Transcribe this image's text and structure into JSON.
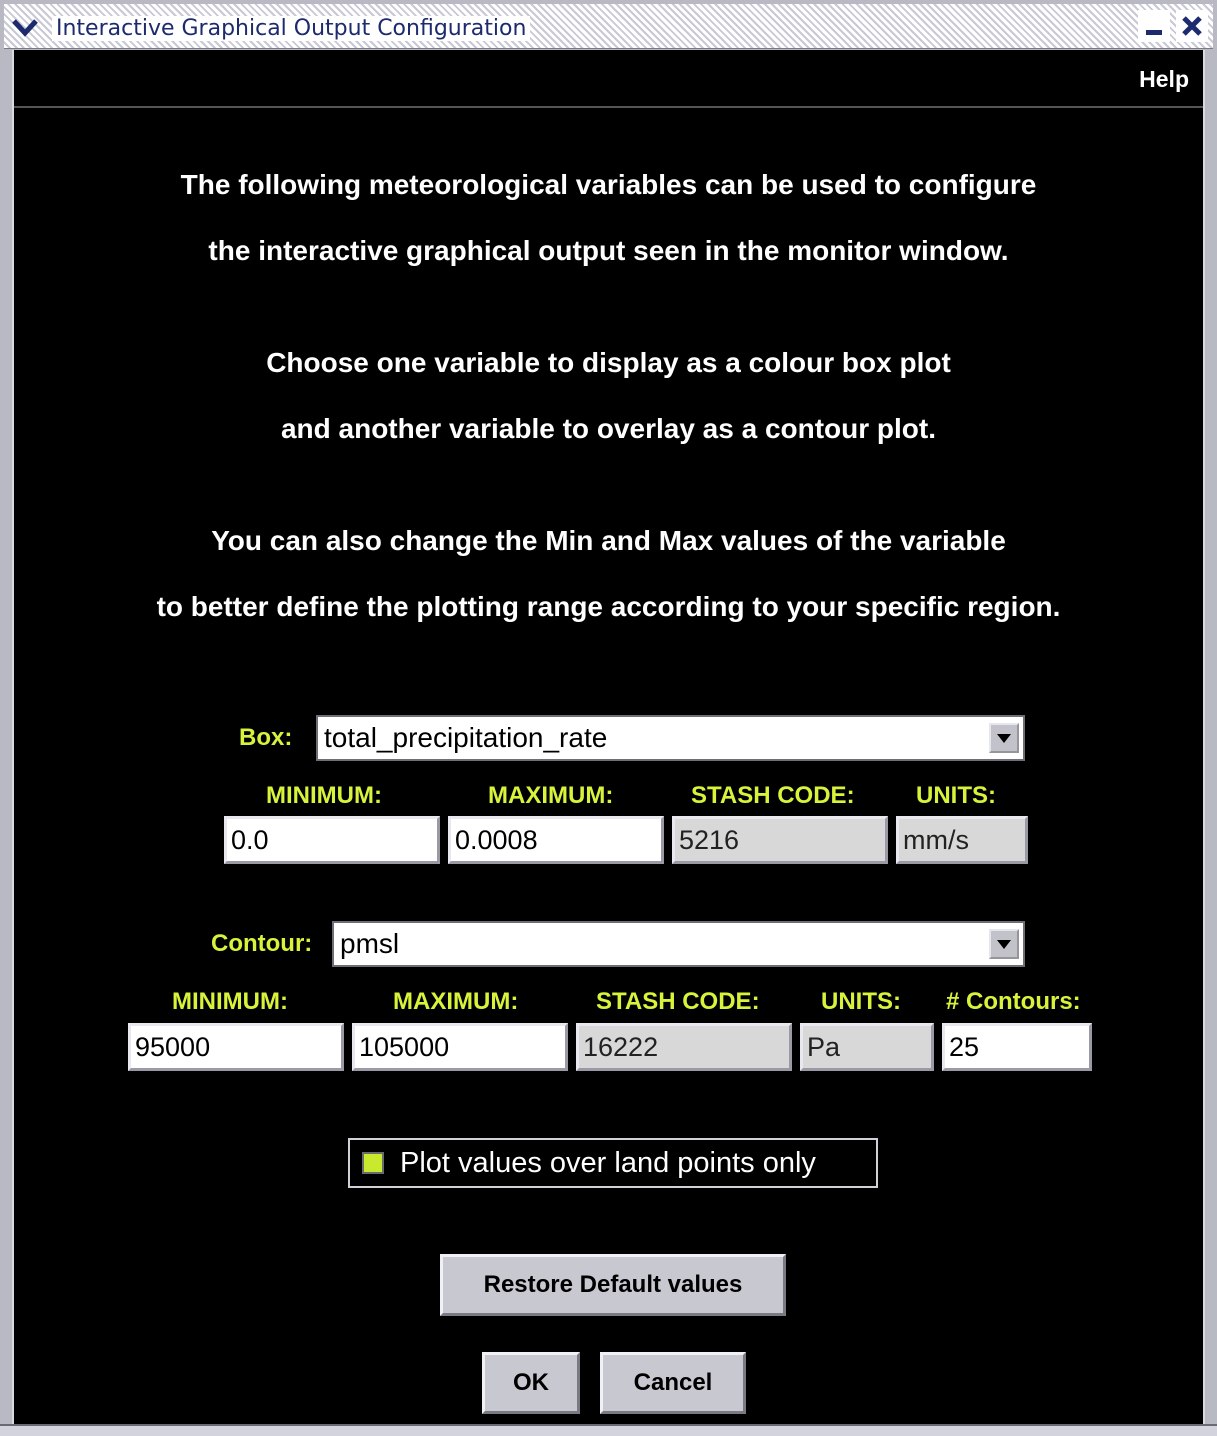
{
  "window": {
    "title": "Interactive Graphical Output Configuration"
  },
  "menubar": {
    "help_label": "Help"
  },
  "intro": {
    "lines": [
      "The following meteorological variables can be used to configure",
      "the interactive graphical output seen in the monitor window.",
      "Choose one variable to display as a colour box plot",
      "and another variable to overlay as a contour plot.",
      "You can also change the Min and Max values of the variable",
      "to better define the plotting range according to your specific region."
    ]
  },
  "box": {
    "label": "Box:",
    "selected": "total_precipitation_rate",
    "minimum_label": "MINIMUM:",
    "maximum_label": "MAXIMUM:",
    "stash_label": "STASH CODE:",
    "units_label": "UNITS:",
    "minimum": "0.0",
    "maximum": "0.0008",
    "stash_code": "5216",
    "units": "mm/s"
  },
  "contour": {
    "label": "Contour:",
    "selected": "pmsl",
    "minimum_label": "MINIMUM:",
    "maximum_label": "MAXIMUM:",
    "stash_label": "STASH CODE:",
    "units_label": "UNITS:",
    "count_label": "# Contours:",
    "minimum": "95000",
    "maximum": "105000",
    "stash_code": "16222",
    "units": "Pa",
    "count": "25"
  },
  "land_only": {
    "label": "Plot values over land points only",
    "checked": true,
    "color": "#c8ea2e"
  },
  "buttons": {
    "restore": "Restore Default values",
    "ok": "OK",
    "cancel": "Cancel"
  },
  "colors": {
    "background": "#000000",
    "label_accent": "#d8f33a",
    "title_text": "#1c2a6e"
  }
}
